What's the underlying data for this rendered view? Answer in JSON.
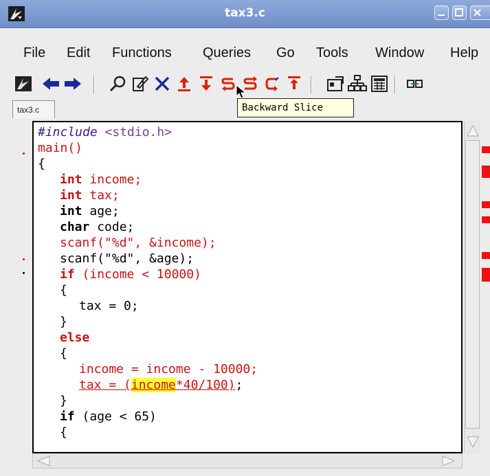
{
  "window": {
    "title": "tax3.c"
  },
  "menu": [
    "File",
    "Edit",
    "Functions",
    "Queries",
    "Go",
    "Tools",
    "Window",
    "Help"
  ],
  "toolbar": {
    "icons": [
      "home-icon",
      "back-arrow-icon",
      "forward-arrow-icon",
      "search-icon",
      "edit-icon",
      "delete-icon",
      "up-arrow-icon",
      "down-arrow-icon",
      "backward-slice-icon",
      "forward-slice-icon",
      "chop-icon",
      "toggle-icon",
      "settings-icon",
      "tree-icon",
      "calculator-icon",
      "link-icon"
    ]
  },
  "tabs": [
    {
      "label": "tax3.c"
    }
  ],
  "tooltip": {
    "text": "Backward Slice"
  },
  "colors": {
    "slice_red": "#cc1111",
    "highlight": "#ffff33",
    "titlebar": "#7e9bd2"
  },
  "code": {
    "l1_kw": "#include",
    "l1_rest": " <stdio.h>",
    "l2": "main()",
    "l3": "{",
    "l4_kw": "int",
    "l4_rest": " income;",
    "l5_kw": "int",
    "l5_rest": " tax;",
    "l6_kw": "int",
    "l6_rest": " age;",
    "l7_kw": "char",
    "l7_rest": " code;",
    "l8": "scanf(\"%d\", &income);",
    "l9": "scanf(\"%d\", &age);",
    "l10_kw": "if",
    "l10_rest": " (income < 10000)",
    "l11": "{",
    "l12": "tax = 0;",
    "l13": "}",
    "l14_kw": "else",
    "l15": "{",
    "l16": "income = income - 10000;",
    "l17_a": "tax = (",
    "l17_hl": "income",
    "l17_b": "*40/100)",
    "l17_c": ";",
    "l18": "}",
    "l19_kw": "if",
    "l19_rest": " (age < 65)",
    "l20": "{"
  }
}
